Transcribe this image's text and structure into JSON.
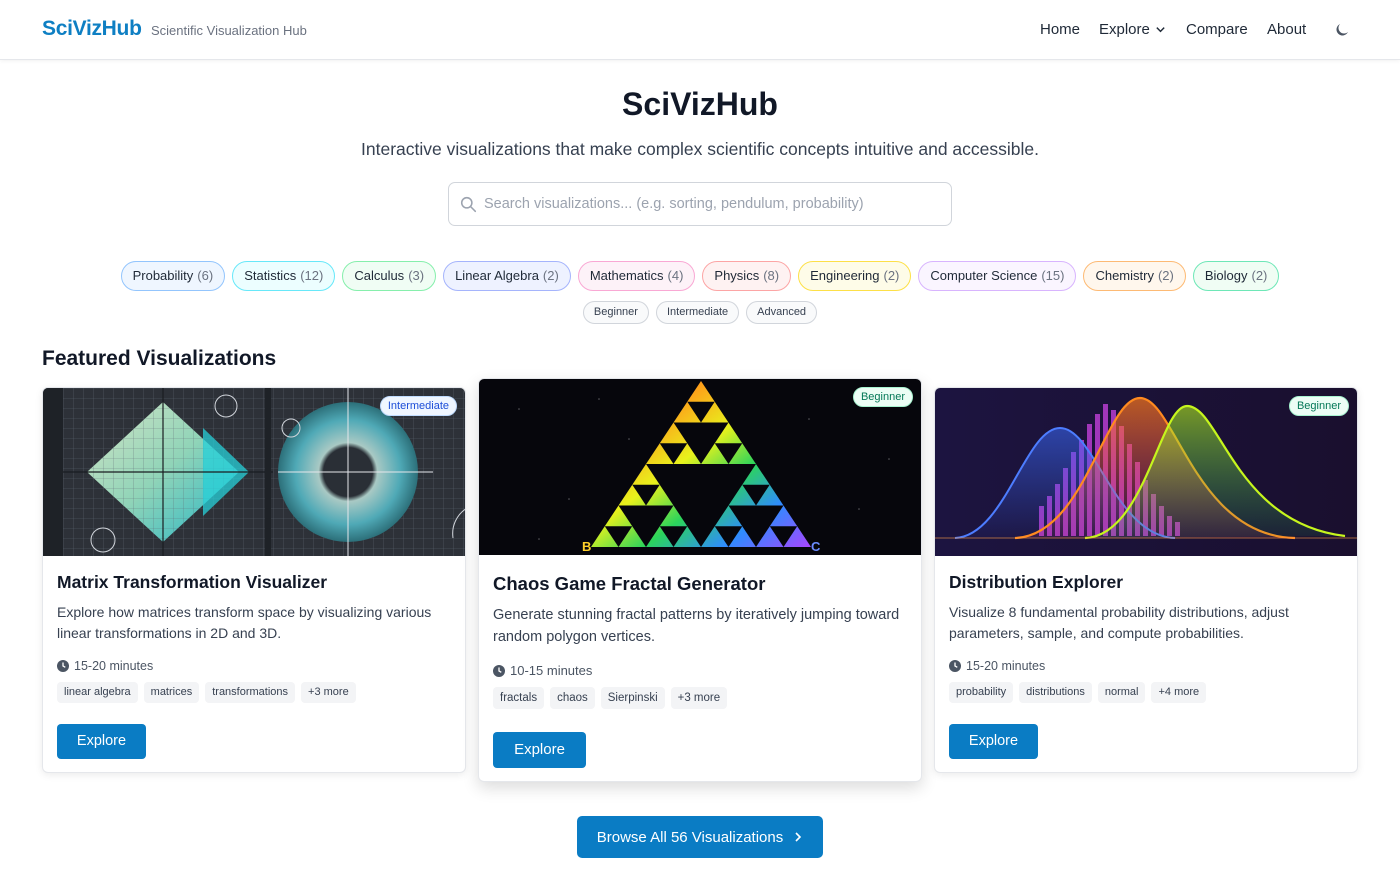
{
  "header": {
    "brand": "SciVizHub",
    "tagline": "Scientific Visualization Hub",
    "nav": {
      "home": "Home",
      "explore": "Explore",
      "compare": "Compare",
      "about": "About"
    }
  },
  "hero": {
    "title": "SciVizHub",
    "subtitle": "Interactive visualizations that make complex scientific concepts intuitive and accessible.",
    "search_placeholder": "Search visualizations... (e.g. sorting, pendulum, probability)"
  },
  "categories": [
    {
      "label": "Probability",
      "count": "(6)",
      "bg": "#eff6ff",
      "border": "#93c5fd"
    },
    {
      "label": "Statistics",
      "count": "(12)",
      "bg": "#ecfeff",
      "border": "#67e8f9"
    },
    {
      "label": "Calculus",
      "count": "(3)",
      "bg": "#f0fdf4",
      "border": "#86efac"
    },
    {
      "label": "Linear Algebra",
      "count": "(2)",
      "bg": "#eef2ff",
      "border": "#a5b4fc"
    },
    {
      "label": "Mathematics",
      "count": "(4)",
      "bg": "#fdf2f8",
      "border": "#f9a8d4"
    },
    {
      "label": "Physics",
      "count": "(8)",
      "bg": "#fef2f2",
      "border": "#fca5a5"
    },
    {
      "label": "Engineering",
      "count": "(2)",
      "bg": "#fefce8",
      "border": "#fde047"
    },
    {
      "label": "Computer Science",
      "count": "(15)",
      "bg": "#faf5ff",
      "border": "#d8b4fe"
    },
    {
      "label": "Chemistry",
      "count": "(2)",
      "bg": "#fff7ed",
      "border": "#fdba74"
    },
    {
      "label": "Biology",
      "count": "(2)",
      "bg": "#f0fdf4",
      "border": "#6ee7b7"
    }
  ],
  "levels": [
    "Beginner",
    "Intermediate",
    "Advanced"
  ],
  "featured": {
    "title": "Featured Visualizations",
    "cards": [
      {
        "badge": "Intermediate",
        "title": "Matrix Transformation Visualizer",
        "description": "Explore how matrices transform space by visualizing various linear transformations in 2D and 3D.",
        "time": "15-20 minutes",
        "tags": [
          "linear algebra",
          "matrices",
          "transformations",
          "+3 more"
        ],
        "button": "Explore"
      },
      {
        "badge": "Beginner",
        "title": "Chaos Game Fractal Generator",
        "description": "Generate stunning fractal patterns by iteratively jumping toward random polygon vertices.",
        "time": "10-15 minutes",
        "tags": [
          "fractals",
          "chaos",
          "Sierpinski",
          "+3 more"
        ],
        "button": "Explore",
        "vertex_labels": [
          "B",
          "C"
        ]
      },
      {
        "badge": "Beginner",
        "title": "Distribution Explorer",
        "description": "Visualize 8 fundamental probability distributions, adjust parameters, sample, and compute probabilities.",
        "time": "15-20 minutes",
        "tags": [
          "probability",
          "distributions",
          "normal",
          "+4 more"
        ],
        "button": "Explore"
      }
    ]
  },
  "browse_button": "Browse All 56 Visualizations",
  "colors": {
    "brand": "#0e7fc3",
    "primary_button": "#0a7cc4"
  }
}
